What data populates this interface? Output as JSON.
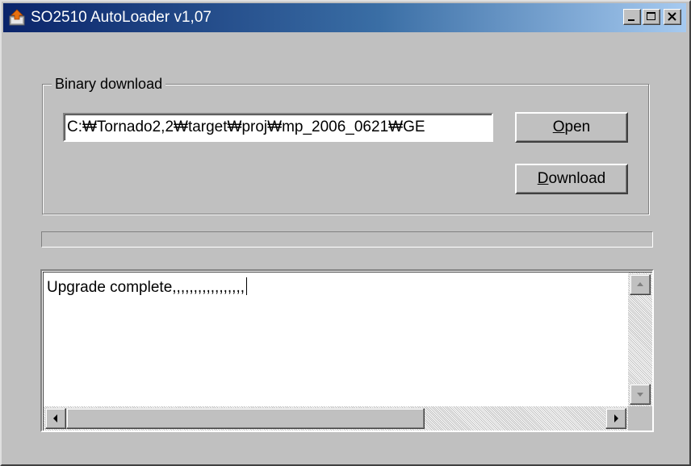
{
  "window": {
    "title": "SO2510 AutoLoader v1,07",
    "buttons": [
      "minimize",
      "maximize",
      "close"
    ]
  },
  "group": {
    "legend": "Binary download"
  },
  "path_field": {
    "value": "C:₩Tornado2,2₩target₩proj₩mp_2006_0621₩GE"
  },
  "buttons": {
    "open": {
      "mnemonic": "O",
      "rest": "pen"
    },
    "download": {
      "mnemonic": "D",
      "rest": "ownload"
    }
  },
  "progress": {
    "value": 0
  },
  "log": {
    "text": "Upgrade complete,,,,,,,,,,,,,,,,,"
  },
  "icons": {
    "app": "autoloader-app-icon",
    "scroll_up": "arrow-up-icon",
    "scroll_down": "arrow-down-icon",
    "scroll_left": "arrow-left-icon",
    "scroll_right": "arrow-right-icon"
  },
  "colors": {
    "titlebar_start": "#0a246a",
    "titlebar_end": "#a6caf0",
    "face": "#c0c0c0"
  }
}
